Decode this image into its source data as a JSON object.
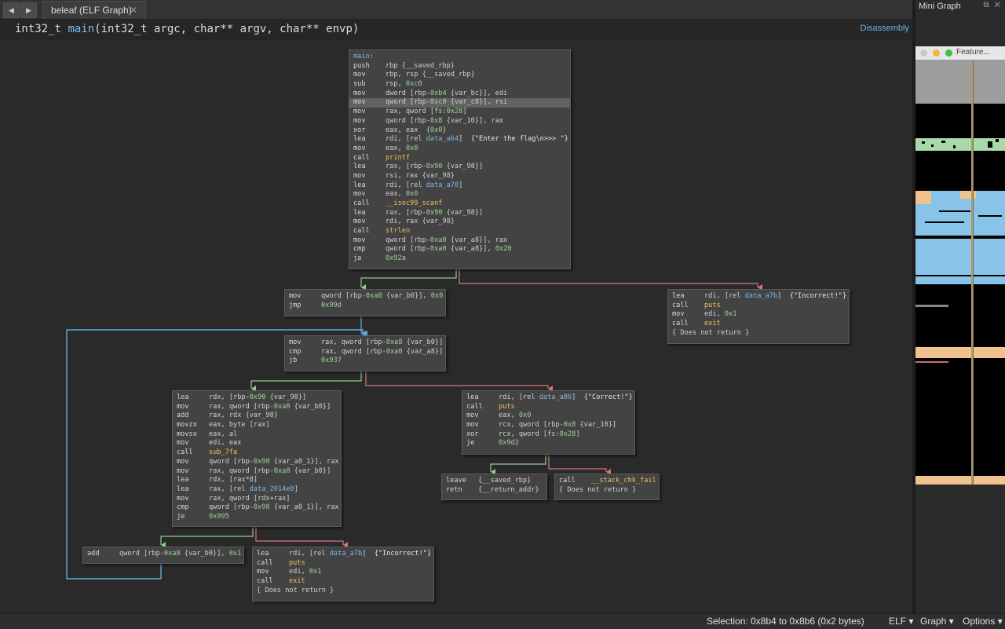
{
  "tab": {
    "title": "beleaf (ELF Graph)",
    "close_glyph": "✕"
  },
  "nav": {
    "back": "◀",
    "forward": "▶"
  },
  "header": {
    "sig_type": "int32_t ",
    "sig_name": "main",
    "sig_args": "(int32_t argc, char** argv, char** envp)",
    "view_mode": "Disassembly"
  },
  "minigraph": {
    "title": "Mini Graph",
    "icons": "⧉ ✕",
    "feature_title": "Feature..."
  },
  "status": {
    "selection": "Selection: 0x8b4 to 0x8b6 (0x2 bytes)",
    "format": "ELF ▾",
    "view": "Graph ▾",
    "options": "Options ▾"
  },
  "colors": {
    "edge_true": "#8fd18a",
    "edge_false": "#d9777b",
    "edge_loop": "#5aaee3",
    "label": "#7fb8e6",
    "symbol": "#f0c060",
    "number": "#9fd39a"
  },
  "blocks": [
    {
      "lines": [
        {
          "label": "main:"
        },
        {
          "m": "push",
          "o": "rbp {__saved_rbp}"
        },
        {
          "m": "mov",
          "o": "rbp, rsp {__saved_rbp}"
        },
        {
          "m": "sub",
          "o": "rsp, 0xc0"
        },
        {
          "m": "mov",
          "o": "dword [rbp-0xb4 {var_bc}], edi"
        },
        {
          "m": "mov",
          "o": "qword [rbp-0xc0 {var_c8}], rsi",
          "hl": true
        },
        {
          "m": "mov",
          "o": "rax, qword [fs:0x28]"
        },
        {
          "m": "mov",
          "o": "qword [rbp-0x8 {var_10}], rax"
        },
        {
          "m": "xor",
          "o": "eax, eax  {0x0}"
        },
        {
          "m": "lea",
          "o": "rdi, [rel data_a64]  {\"Enter the flag\\n>>> \"}"
        },
        {
          "m": "mov",
          "o": "eax, 0x0"
        },
        {
          "m": "call",
          "o": "printf"
        },
        {
          "m": "lea",
          "o": "rax, [rbp-0x90 {var_98}]"
        },
        {
          "m": "mov",
          "o": "rsi, rax {var_98}"
        },
        {
          "m": "lea",
          "o": "rdi, [rel data_a78]"
        },
        {
          "m": "mov",
          "o": "eax, 0x0"
        },
        {
          "m": "call",
          "o": "__isoc99_scanf"
        },
        {
          "m": "lea",
          "o": "rax, [rbp-0x90 {var_98}]"
        },
        {
          "m": "mov",
          "o": "rdi, rax {var_98}"
        },
        {
          "m": "call",
          "o": "strlen"
        },
        {
          "m": "mov",
          "o": "qword [rbp-0xa0 {var_a8}], rax"
        },
        {
          "m": "cmp",
          "o": "qword [rbp-0xa0 {var_a8}], 0x20"
        },
        {
          "m": "ja",
          "o": "0x92a"
        }
      ]
    },
    {
      "lines": [
        {
          "m": "mov",
          "o": "qword [rbp-0xa8 {var_b0}], 0x0"
        },
        {
          "m": "jmp",
          "o": "0x99d"
        }
      ]
    },
    {
      "lines": [
        {
          "m": "lea",
          "o": "rdi, [rel data_a7b]  {\"Incorrect!\"}"
        },
        {
          "m": "call",
          "o": "puts"
        },
        {
          "m": "mov",
          "o": "edi, 0x1"
        },
        {
          "m": "call",
          "o": "exit"
        },
        {
          "raw": "{ Does not return }"
        }
      ]
    },
    {
      "lines": [
        {
          "m": "mov",
          "o": "rax, qword [rbp-0xa8 {var_b0}]"
        },
        {
          "m": "cmp",
          "o": "rax, qword [rbp-0xa0 {var_a8}]"
        },
        {
          "m": "jb",
          "o": "0x937"
        }
      ]
    },
    {
      "lines": [
        {
          "m": "lea",
          "o": "rdx, [rbp-0x90 {var_98}]"
        },
        {
          "m": "mov",
          "o": "rax, qword [rbp-0xa8 {var_b0}]"
        },
        {
          "m": "add",
          "o": "rax, rdx {var_98}"
        },
        {
          "m": "movzx",
          "o": "eax, byte [rax]"
        },
        {
          "m": "movsx",
          "o": "eax, al"
        },
        {
          "m": "mov",
          "o": "edi, eax"
        },
        {
          "m": "call",
          "o": "sub_7fa"
        },
        {
          "m": "mov",
          "o": "qword [rbp-0x98 {var_a0_1}], rax"
        },
        {
          "m": "mov",
          "o": "rax, qword [rbp-0xa8 {var_b0}]"
        },
        {
          "m": "lea",
          "o": "rdx, [rax*8]"
        },
        {
          "m": "lea",
          "o": "rax, [rel data_2014e0]"
        },
        {
          "m": "mov",
          "o": "rax, qword [rdx+rax]"
        },
        {
          "m": "cmp",
          "o": "qword [rbp-0x98 {var_a0_1}], rax"
        },
        {
          "m": "je",
          "o": "0x995"
        }
      ]
    },
    {
      "lines": [
        {
          "m": "lea",
          "o": "rdi, [rel data_a86]  {\"Correct!\"}"
        },
        {
          "m": "call",
          "o": "puts"
        },
        {
          "m": "mov",
          "o": "eax, 0x0"
        },
        {
          "m": "mov",
          "o": "rcx, qword [rbp-0x8 {var_10}]"
        },
        {
          "m": "xor",
          "o": "rcx, qword [fs:0x28]"
        },
        {
          "m": "je",
          "o": "0x9d2"
        }
      ]
    },
    {
      "lines": [
        {
          "m": "leave",
          "o": "{__saved_rbp}"
        },
        {
          "m": "retn",
          "o": "{__return_addr}"
        }
      ]
    },
    {
      "lines": [
        {
          "m": "call",
          "o": "__stack_chk_fail"
        },
        {
          "raw": "{ Does not return }"
        }
      ]
    },
    {
      "lines": [
        {
          "m": "add",
          "o": "qword [rbp-0xa8 {var_b0}], 0x1"
        }
      ]
    },
    {
      "lines": [
        {
          "m": "lea",
          "o": "rdi, [rel data_a7b]  {\"Incorrect!\"}"
        },
        {
          "m": "call",
          "o": "puts"
        },
        {
          "m": "mov",
          "o": "edi, 0x1"
        },
        {
          "m": "call",
          "o": "exit"
        },
        {
          "raw": "{ Does not return }"
        }
      ]
    }
  ]
}
